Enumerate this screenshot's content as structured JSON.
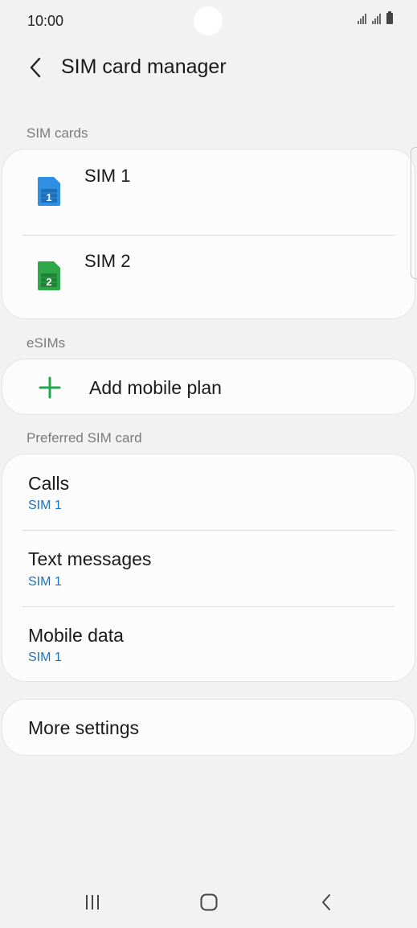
{
  "status_bar": {
    "time": "10:00"
  },
  "header": {
    "title": "SIM card manager"
  },
  "sections": {
    "sim_cards": "SIM cards",
    "esims": "eSIMs",
    "preferred": "Preferred SIM card"
  },
  "sim_cards": [
    {
      "label": "SIM 1",
      "badge": "1",
      "color": "#2f8fe0"
    },
    {
      "label": "SIM 2",
      "badge": "2",
      "color": "#2fa84a"
    }
  ],
  "esim": {
    "add_label": "Add mobile plan",
    "accent": "#20a84a"
  },
  "preferred": [
    {
      "title": "Calls",
      "value": "SIM 1"
    },
    {
      "title": "Text messages",
      "value": "SIM 1"
    },
    {
      "title": "Mobile data",
      "value": "SIM 1"
    }
  ],
  "more_settings": {
    "label": "More settings"
  },
  "icons": [
    "back-arrow-icon",
    "sim-card-icon",
    "plus-icon",
    "recents-icon",
    "home-icon",
    "nav-back-icon"
  ]
}
